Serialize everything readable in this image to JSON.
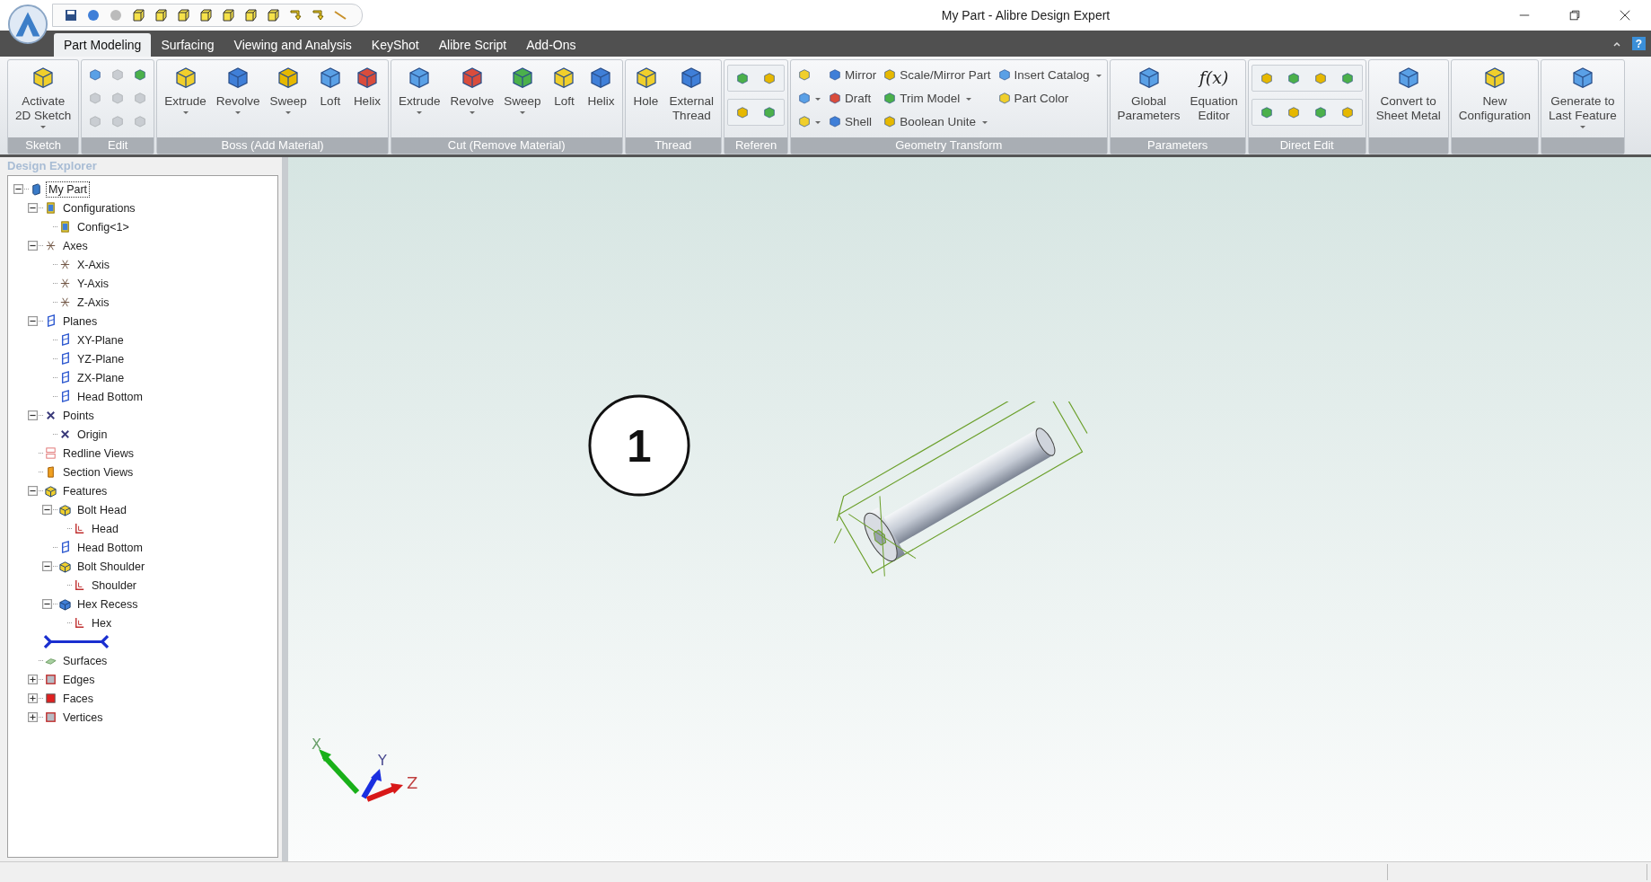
{
  "window": {
    "title": "My Part - Alibre Design Expert"
  },
  "tabs": [
    {
      "label": "Part Modeling",
      "selected": true
    },
    {
      "label": "Surfacing",
      "selected": false
    },
    {
      "label": "Viewing and Analysis",
      "selected": false
    },
    {
      "label": "KeyShot",
      "selected": false
    },
    {
      "label": "Alibre Script",
      "selected": false
    },
    {
      "label": "Add-Ons",
      "selected": false
    }
  ],
  "help": "?",
  "ribbon": [
    {
      "label": "Sketch",
      "items": [
        {
          "kind": "large",
          "lines": [
            "Activate",
            "2D Sketch"
          ],
          "dropdown": true
        }
      ]
    },
    {
      "label": "Edit",
      "items": [
        {
          "kind": "column",
          "buttons": [
            {
              "kind": "icon",
              "disabled": false
            },
            {
              "kind": "icon",
              "disabled": true
            },
            {
              "kind": "icon",
              "disabled": true
            }
          ]
        },
        {
          "kind": "column",
          "buttons": [
            {
              "kind": "icon",
              "disabled": true
            },
            {
              "kind": "icon",
              "disabled": true
            },
            {
              "kind": "icon",
              "disabled": true
            }
          ]
        },
        {
          "kind": "column",
          "buttons": [
            {
              "kind": "icon",
              "disabled": false
            },
            {
              "kind": "icon",
              "disabled": true
            },
            {
              "kind": "icon",
              "disabled": true
            }
          ]
        }
      ]
    },
    {
      "label": "Boss (Add Material)",
      "items": [
        {
          "kind": "large",
          "lines": [
            "Extrude"
          ],
          "dropdown": true
        },
        {
          "kind": "large",
          "lines": [
            "Revolve"
          ],
          "dropdown": true
        },
        {
          "kind": "large",
          "lines": [
            "Sweep"
          ],
          "dropdown": true
        },
        {
          "kind": "large",
          "lines": [
            "Loft"
          ],
          "dropdown": false
        },
        {
          "kind": "large",
          "lines": [
            "Helix"
          ],
          "dropdown": false
        }
      ]
    },
    {
      "label": "Cut (Remove Material)",
      "items": [
        {
          "kind": "large",
          "lines": [
            "Extrude"
          ],
          "dropdown": true
        },
        {
          "kind": "large",
          "lines": [
            "Revolve"
          ],
          "dropdown": true
        },
        {
          "kind": "large",
          "lines": [
            "Sweep"
          ],
          "dropdown": true
        },
        {
          "kind": "large",
          "lines": [
            "Loft"
          ],
          "dropdown": false
        },
        {
          "kind": "large",
          "lines": [
            "Helix"
          ],
          "dropdown": false
        }
      ]
    },
    {
      "label": "Thread",
      "items": [
        {
          "kind": "large",
          "lines": [
            "Hole"
          ],
          "dropdown": false
        },
        {
          "kind": "large",
          "lines": [
            "External",
            "Thread"
          ],
          "dropdown": false
        }
      ]
    },
    {
      "label": "Referen",
      "items": [
        {
          "kind": "strips",
          "rows": [
            [
              {
                "disabled": false
              },
              {
                "disabled": false
              }
            ],
            [
              {
                "disabled": false
              },
              {
                "disabled": false
              }
            ]
          ]
        }
      ]
    },
    {
      "label": "Geometry Transform",
      "items": [
        {
          "kind": "column",
          "buttons": [
            {
              "kind": "icon",
              "disabled": false,
              "dropdown": false
            },
            {
              "kind": "icon",
              "disabled": false,
              "dropdown": true
            },
            {
              "kind": "icon",
              "disabled": false,
              "dropdown": true
            }
          ]
        },
        {
          "kind": "column",
          "buttons": [
            {
              "kind": "small",
              "label": "Mirror",
              "dropdown": false
            },
            {
              "kind": "small",
              "label": "Draft",
              "dropdown": false
            },
            {
              "kind": "small",
              "label": "Shell",
              "dropdown": false
            }
          ]
        },
        {
          "kind": "column",
          "buttons": [
            {
              "kind": "small",
              "label": "Scale/Mirror Part",
              "dropdown": false
            },
            {
              "kind": "small",
              "label": "Trim Model",
              "dropdown": true
            },
            {
              "kind": "small",
              "label": "Boolean Unite",
              "dropdown": true
            }
          ]
        },
        {
          "kind": "column",
          "buttons": [
            {
              "kind": "small",
              "label": "Insert Catalog",
              "dropdown": true
            },
            {
              "kind": "small",
              "label": "Part Color",
              "dropdown": false
            }
          ]
        }
      ]
    },
    {
      "label": "Parameters",
      "items": [
        {
          "kind": "large",
          "lines": [
            "Global",
            "Parameters"
          ],
          "dropdown": false
        },
        {
          "kind": "large",
          "lines": [
            "Equation",
            "Editor"
          ],
          "glyph": "f(x)",
          "dropdown": false
        }
      ]
    },
    {
      "label": "Direct Edit",
      "items": [
        {
          "kind": "strips",
          "rows": [
            [
              {
                "disabled": false
              },
              {
                "disabled": false
              },
              {
                "disabled": false
              },
              {
                "disabled": false
              }
            ],
            [
              {
                "disabled": false
              },
              {
                "disabled": false
              },
              {
                "disabled": false
              },
              {
                "disabled": false
              }
            ]
          ]
        }
      ]
    },
    {
      "items": [
        {
          "kind": "large",
          "lines": [
            "Convert to",
            "Sheet Metal"
          ],
          "dropdown": false
        }
      ]
    },
    {
      "items": [
        {
          "kind": "large",
          "lines": [
            "New",
            "Configuration"
          ],
          "dropdown": false
        }
      ]
    },
    {
      "items": [
        {
          "kind": "large",
          "lines": [
            "Generate to",
            "Last Feature"
          ],
          "dropdown": true
        }
      ]
    }
  ],
  "explorer": {
    "title": "Design Explorer",
    "tree": [
      {
        "label": "My Part",
        "kind": "part",
        "expanded": true,
        "selected": true,
        "children": [
          {
            "label": "Configurations",
            "kind": "config",
            "expanded": true,
            "selected": false,
            "children": [
              {
                "label": "Config<1>",
                "kind": "config",
                "selected": false
              }
            ]
          },
          {
            "label": "Axes",
            "kind": "axis",
            "expanded": true,
            "selected": false,
            "children": [
              {
                "label": "X-Axis",
                "kind": "axis",
                "selected": false
              },
              {
                "label": "Y-Axis",
                "kind": "axis",
                "selected": false
              },
              {
                "label": "Z-Axis",
                "kind": "axis",
                "selected": false
              }
            ]
          },
          {
            "label": "Planes",
            "kind": "plane",
            "expanded": true,
            "selected": false,
            "children": [
              {
                "label": "XY-Plane",
                "kind": "plane",
                "selected": false
              },
              {
                "label": "YZ-Plane",
                "kind": "plane",
                "selected": false
              },
              {
                "label": "ZX-Plane",
                "kind": "plane",
                "selected": false
              },
              {
                "label": "Head Bottom",
                "kind": "plane",
                "selected": false
              }
            ]
          },
          {
            "label": "Points",
            "kind": "point",
            "expanded": true,
            "selected": false,
            "children": [
              {
                "label": "Origin",
                "kind": "point",
                "selected": false
              }
            ]
          },
          {
            "label": "Redline Views",
            "kind": "redline",
            "selected": false
          },
          {
            "label": "Section Views",
            "kind": "section",
            "selected": false
          },
          {
            "label": "Features",
            "kind": "feature",
            "expanded": true,
            "selected": false,
            "children": [
              {
                "label": "Bolt Head",
                "kind": "feature",
                "expanded": true,
                "selected": false,
                "children": [
                  {
                    "label": "Head",
                    "kind": "sketch",
                    "selected": false
                  }
                ]
              },
              {
                "label": "Head Bottom",
                "kind": "plane",
                "selected": false
              },
              {
                "label": "Bolt Shoulder",
                "kind": "feature",
                "expanded": true,
                "selected": false,
                "children": [
                  {
                    "label": "Shoulder",
                    "kind": "sketch",
                    "selected": false
                  }
                ]
              },
              {
                "label": "Hex Recess",
                "kind": "cut",
                "expanded": true,
                "selected": false,
                "children": [
                  {
                    "label": "Hex",
                    "kind": "sketch",
                    "selected": false
                  }
                ]
              }
            ]
          },
          {
            "kind": "rollback"
          },
          {
            "label": "Surfaces",
            "kind": "surfaces",
            "selected": false
          },
          {
            "label": "Edges",
            "kind": "edges",
            "expanded": false,
            "selected": false
          },
          {
            "label": "Faces",
            "kind": "faces",
            "expanded": false,
            "selected": false
          },
          {
            "label": "Vertices",
            "kind": "vertices",
            "expanded": false,
            "selected": false
          }
        ]
      }
    ]
  },
  "viewport": {
    "callout": "1",
    "triad": [
      "X",
      "Y",
      "Z"
    ]
  }
}
